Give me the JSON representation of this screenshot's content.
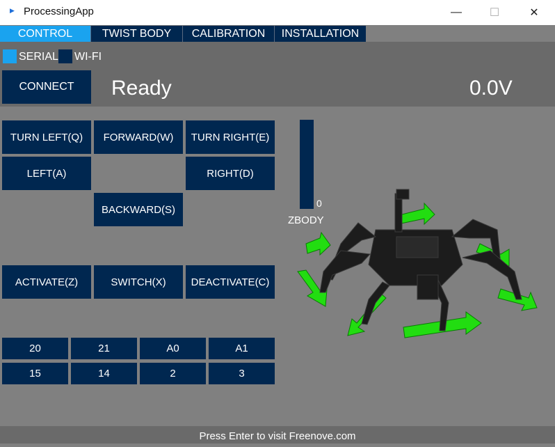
{
  "window": {
    "title": "ProcessingApp",
    "minimize_glyph": "—",
    "maximize_glyph": "☐",
    "close_glyph": "✕"
  },
  "tabs": [
    {
      "label": "CONTROL",
      "active": true
    },
    {
      "label": "TWIST BODY",
      "active": false
    },
    {
      "label": "CALIBRATION",
      "active": false
    },
    {
      "label": "INSTALLATION",
      "active": false
    }
  ],
  "connection": {
    "serial_label": "SERIAL",
    "serial_checked": true,
    "wifi_label": "WI-FI",
    "wifi_checked": false,
    "connect_label": "CONNECT",
    "status": "Ready",
    "voltage": "0.0V"
  },
  "movement": {
    "turn_left": "TURN LEFT(Q)",
    "forward": "FORWARD(W)",
    "turn_right": "TURN RIGHT(E)",
    "left": "LEFT(A)",
    "right": "RIGHT(D)",
    "backward": "BACKWARD(S)"
  },
  "actions": {
    "activate": "ACTIVATE(Z)",
    "switch": "SWITCH(X)",
    "deactivate": "DEACTIVATE(C)"
  },
  "pins": {
    "row1": [
      "20",
      "21",
      "A0",
      "A1"
    ],
    "row2": [
      "15",
      "14",
      "2",
      "3"
    ]
  },
  "zbody": {
    "label": "ZBODY",
    "value": "0"
  },
  "colors": {
    "accent": "#1aa3ef",
    "button": "#002750",
    "background": "#808080",
    "panel": "#6a6a6a",
    "arrow": "#22dd11"
  },
  "footer": "Press Enter to visit Freenove.com"
}
